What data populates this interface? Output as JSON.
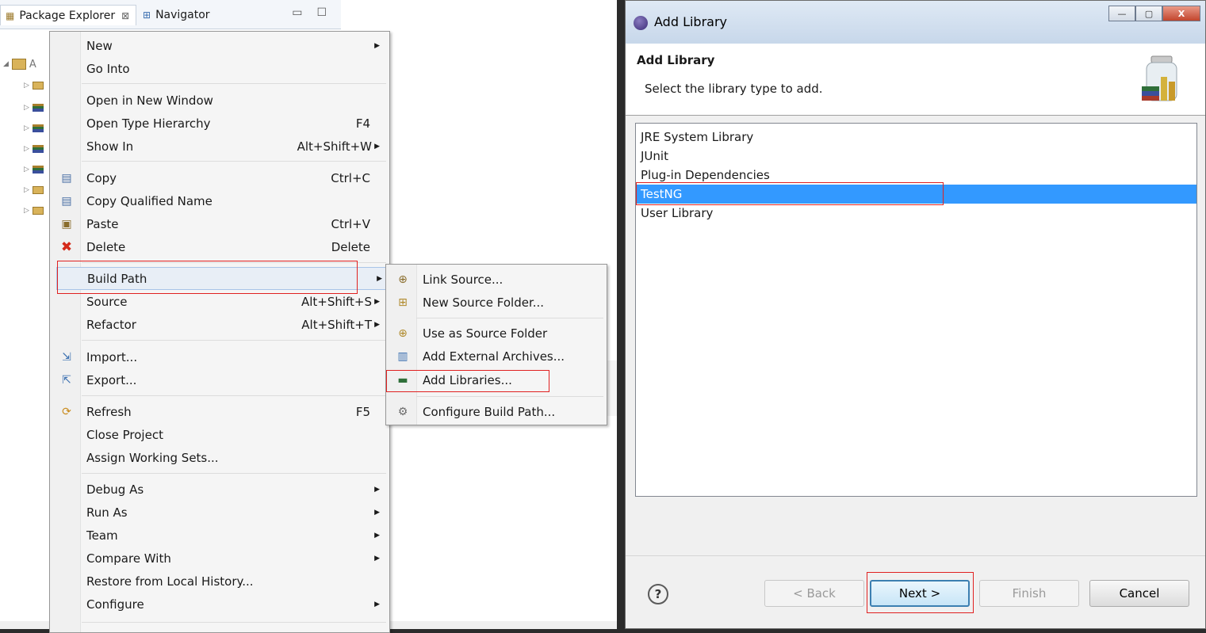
{
  "eclipse": {
    "tabs": [
      {
        "label": "Package Explorer",
        "close": "⊠"
      },
      {
        "label": "Navigator"
      }
    ],
    "view_controls": {
      "minimize": "▭",
      "maximize": "☐"
    },
    "tree": {
      "project_label_fragment": "A"
    }
  },
  "context_menu": {
    "items": [
      {
        "label": "New",
        "key": "",
        "submenu": true
      },
      {
        "label": "Go Into",
        "key": ""
      },
      {
        "label": "Open in New Window",
        "key": ""
      },
      {
        "label": "Open Type Hierarchy",
        "key": "F4"
      },
      {
        "label": "Show In",
        "key": "Alt+Shift+W",
        "submenu": true
      },
      {
        "label": "Copy",
        "key": "Ctrl+C",
        "icon": "copy-icon"
      },
      {
        "label": "Copy Qualified Name",
        "key": "",
        "icon": "copy-qualified-icon"
      },
      {
        "label": "Paste",
        "key": "Ctrl+V",
        "icon": "paste-icon"
      },
      {
        "label": "Delete",
        "key": "Delete",
        "icon": "delete-icon"
      },
      {
        "label": "Build Path",
        "key": "",
        "submenu": true,
        "highlighted": true
      },
      {
        "label": "Source",
        "key": "Alt+Shift+S",
        "submenu": true
      },
      {
        "label": "Refactor",
        "key": "Alt+Shift+T",
        "submenu": true
      },
      {
        "label": "Import...",
        "key": "",
        "icon": "import-icon"
      },
      {
        "label": "Export...",
        "key": "",
        "icon": "export-icon"
      },
      {
        "label": "Refresh",
        "key": "F5",
        "icon": "refresh-icon"
      },
      {
        "label": "Close Project",
        "key": ""
      },
      {
        "label": "Assign Working Sets...",
        "key": ""
      },
      {
        "label": "Debug As",
        "key": "",
        "submenu": true
      },
      {
        "label": "Run As",
        "key": "",
        "submenu": true
      },
      {
        "label": "Team",
        "key": "",
        "submenu": true
      },
      {
        "label": "Compare With",
        "key": "",
        "submenu": true
      },
      {
        "label": "Restore from Local History...",
        "key": ""
      },
      {
        "label": "Configure",
        "key": "",
        "submenu": true
      }
    ]
  },
  "build_path_submenu": {
    "items": [
      {
        "label": "Link Source...",
        "icon": "link-source-icon"
      },
      {
        "label": "New Source Folder...",
        "icon": "new-source-folder-icon"
      },
      {
        "label": "Use as Source Folder",
        "icon": "use-source-folder-icon"
      },
      {
        "label": "Add External Archives...",
        "icon": "external-archive-icon"
      },
      {
        "label": "Add Libraries...",
        "icon": "add-libraries-icon"
      },
      {
        "label": "Configure Build Path...",
        "icon": "configure-build-path-icon"
      }
    ]
  },
  "dialog": {
    "window_title": "Add Library",
    "header_title": "Add Library",
    "header_subtitle": "Select the library type to add.",
    "libraries": [
      {
        "label": "JRE System Library"
      },
      {
        "label": "JUnit"
      },
      {
        "label": "Plug-in Dependencies"
      },
      {
        "label": "TestNG",
        "selected": true
      },
      {
        "label": "User Library"
      }
    ],
    "buttons": {
      "help": "?",
      "back": "< Back",
      "next": "Next >",
      "finish": "Finish",
      "cancel": "Cancel"
    },
    "window_buttons": {
      "minimize": "—",
      "maximize": "▢",
      "close": "X"
    }
  },
  "colors": {
    "selection": "#3399ff",
    "annotation_red": "#e02020"
  }
}
